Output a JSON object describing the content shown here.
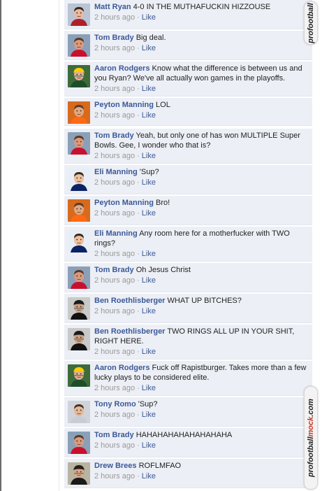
{
  "comments": [
    {
      "id": "c1",
      "name": "Matt Ryan",
      "text": "4-0 IN THE MUTHAFUCKIN HIZZOUSE",
      "time": "2 hours ago",
      "like": "Like",
      "avatar": "matt-ryan"
    },
    {
      "id": "c2",
      "name": "Tom Brady",
      "text": "Big deal.",
      "time": "2 hours ago",
      "like": "Like",
      "avatar": "tom-brady"
    },
    {
      "id": "c3",
      "name": "Aaron Rodgers",
      "text": "Know what the difference is between us and you Ryan? We've all actually won games in the playoffs.",
      "time": "2 hours ago",
      "like": "Like",
      "avatar": "aaron-rodgers"
    },
    {
      "id": "c4",
      "name": "Peyton Manning",
      "text": "LOL",
      "time": "2 hours ago",
      "like": "Like",
      "avatar": "peyton-manning"
    },
    {
      "id": "c5",
      "name": "Tom Brady",
      "text": "Yeah, but only one of has won MULTIPLE Super Bowls. Gee, I wonder who that is?",
      "time": "2 hours ago",
      "like": "Like",
      "avatar": "tom-brady"
    },
    {
      "id": "c6",
      "name": "Eli Manning",
      "text": "'Sup?",
      "time": "2 hours ago",
      "like": "Like",
      "avatar": "eli-manning"
    },
    {
      "id": "c7",
      "name": "Peyton Manning",
      "text": "Bro!",
      "time": "2 hours ago",
      "like": "Like",
      "avatar": "peyton-manning"
    },
    {
      "id": "c8",
      "name": "Eli Manning",
      "text": "Any room here for a motherfucker with TWO rings?",
      "time": "2 hours ago",
      "like": "Like",
      "avatar": "eli-manning"
    },
    {
      "id": "c9",
      "name": "Tom Brady",
      "text": "Oh Jesus Christ",
      "time": "2 hours ago",
      "like": "Like",
      "avatar": "tom-brady"
    },
    {
      "id": "c10",
      "name": "Ben Roethlisberger",
      "text": "WHAT UP BITCHES?",
      "time": "2 hours ago",
      "like": "Like",
      "avatar": "ben-roethlisberger"
    },
    {
      "id": "c11",
      "name": "Ben Roethlisberger",
      "text": "TWO RINGS ALL UP IN YOUR SHIT, RIGHT HERE.",
      "time": "2 hours ago",
      "like": "Like",
      "avatar": "ben-roethlisberger"
    },
    {
      "id": "c12",
      "name": "Aaron Rodgers",
      "text": "Fuck off Rapistburger. Takes more than a few lucky plays to be considered elite.",
      "time": "2 hours ago",
      "like": "Like",
      "avatar": "aaron-rodgers"
    },
    {
      "id": "c13",
      "name": "Tony Romo",
      "text": "'Sup?",
      "time": "2 hours ago",
      "like": "Like",
      "avatar": "tony-romo"
    },
    {
      "id": "c14",
      "name": "Tom Brady",
      "text": "HAHAHAHAHAHAHAHAHA",
      "time": "2 hours ago",
      "like": "Like",
      "avatar": "tom-brady"
    },
    {
      "id": "c15",
      "name": "Drew Brees",
      "text": "ROFLMFAO",
      "time": "2 hours ago",
      "like": "Like",
      "avatar": "drew-brees"
    }
  ],
  "watermark": {
    "prefix": "profootball",
    "accent": "mock",
    "suffix": ".com"
  },
  "colors": {
    "name": "#3b5998",
    "comment_bg": "#eceff5",
    "meta": "#999999",
    "accent": "#c0392b"
  }
}
